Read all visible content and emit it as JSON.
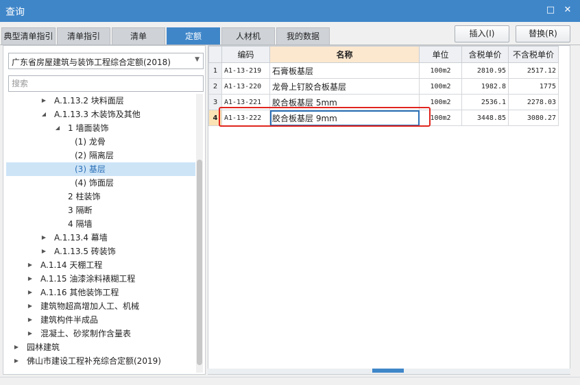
{
  "window": {
    "title": "查询",
    "maximize_glyph": "□",
    "close_glyph": "✕"
  },
  "tabs": [
    "典型清单指引",
    "清单指引",
    "清单",
    "定额",
    "人材机",
    "我的数据"
  ],
  "active_tab": "定额",
  "buttons": {
    "insert": "插入(I)",
    "replace": "替换(R)"
  },
  "left": {
    "combo_value": "广东省房屋建筑与装饰工程综合定额(2018)",
    "search_placeholder": "搜索",
    "tree": [
      {
        "label": "A.1.13.2 块料面层",
        "toggle": "▶",
        "level": 2
      },
      {
        "label": "A.1.13.3 木装饰及其他",
        "toggle": "◢",
        "level": 2
      },
      {
        "label": "1 墙面装饰",
        "toggle": "◢",
        "level": 3
      },
      {
        "label": "(1) 龙骨",
        "toggle": "",
        "level": 4
      },
      {
        "label": "(2) 隔离层",
        "toggle": "",
        "level": 4
      },
      {
        "label": "(3) 基层",
        "toggle": "",
        "level": 4,
        "selected": true
      },
      {
        "label": "(4) 饰面层",
        "toggle": "",
        "level": 4
      },
      {
        "label": "2 柱装饰",
        "toggle": "",
        "level": 3
      },
      {
        "label": "3 隔断",
        "toggle": "",
        "level": 3
      },
      {
        "label": "4 隔墙",
        "toggle": "",
        "level": 3
      },
      {
        "label": "A.1.13.4 幕墙",
        "toggle": "▶",
        "level": 2
      },
      {
        "label": "A.1.13.5 砖装饰",
        "toggle": "▶",
        "level": 2
      },
      {
        "label": "A.1.14 天棚工程",
        "toggle": "▶",
        "level": 1
      },
      {
        "label": "A.1.15 油漆涂料裱糊工程",
        "toggle": "▶",
        "level": 1
      },
      {
        "label": "A.1.16 其他装饰工程",
        "toggle": "▶",
        "level": 1
      },
      {
        "label": "建筑物超高增加人工、机械",
        "toggle": "▶",
        "level": 1
      },
      {
        "label": "建筑构件半成品",
        "toggle": "▶",
        "level": 1
      },
      {
        "label": "混凝土、砂浆制作含量表",
        "toggle": "▶",
        "level": 1
      },
      {
        "label": "园林建筑",
        "toggle": "▶",
        "level": 0
      },
      {
        "label": "佛山市建设工程补充综合定额(2019)",
        "toggle": "▶",
        "level": 0
      }
    ]
  },
  "grid": {
    "columns": [
      "编码",
      "名称",
      "单位",
      "含税单价",
      "不含税单价"
    ],
    "rows": [
      {
        "no": "1",
        "code": "A1-13-219",
        "name": "石膏板基层",
        "unit": "100m2",
        "price_tax": "2810.95",
        "price_notax": "2517.12"
      },
      {
        "no": "2",
        "code": "A1-13-220",
        "name": "龙骨上钉胶合板基层",
        "unit": "100m2",
        "price_tax": "1982.8",
        "price_notax": "1775"
      },
      {
        "no": "3",
        "code": "A1-13-221",
        "name": "胶合板基层 5mm",
        "unit": "100m2",
        "price_tax": "2536.1",
        "price_notax": "2278.03"
      },
      {
        "no": "4",
        "code": "A1-13-222",
        "name": "胶合板基层 9mm",
        "unit": "100m2",
        "price_tax": "3448.85",
        "price_notax": "3080.27"
      }
    ],
    "current_row": 3
  },
  "colors": {
    "accent": "#3f86c9",
    "highlight_border": "#e0231c",
    "selected_bg": "#cde4f7",
    "name_header_bg": "#fce8cf"
  }
}
